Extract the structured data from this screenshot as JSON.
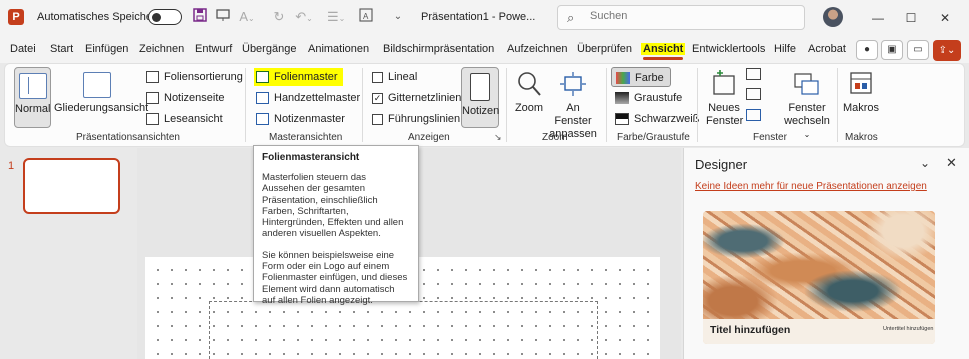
{
  "titlebar": {
    "app_logo": "P",
    "autosave_label": "Automatisches Speichern",
    "autosave_toggle": "off",
    "doc_title": "Präsentation1  -  Powe...",
    "search_placeholder": "Suchen"
  },
  "menu": {
    "tabs": [
      "Datei",
      "Start",
      "Einfügen",
      "Zeichnen",
      "Entwurf",
      "Übergänge",
      "Animationen",
      "Bildschirmpräsentation",
      "Aufzeichnen",
      "Überprüfen",
      "Ansicht",
      "Entwicklertools",
      "Hilfe",
      "Acrobat"
    ],
    "active_tab": "Ansicht"
  },
  "ribbon": {
    "presentation_views": {
      "label": "Präsentationsansichten",
      "normal": "Normal",
      "outline": "Gliederungsansicht",
      "slide_sorter": "Foliensortierung",
      "notes_page": "Notizenseite",
      "reading_view": "Leseansicht"
    },
    "master_views": {
      "label": "Masteransichten",
      "slide_master": "Folienmaster",
      "handout_master": "Handzettelmaster",
      "notes_master": "Notizenmaster"
    },
    "show": {
      "label": "Anzeigen",
      "ruler": "Lineal",
      "gridlines": "Gitternetzlinien",
      "guides": "Führungslinien",
      "notes": "Notizen"
    },
    "zoom": {
      "label": "Zoom",
      "zoom": "Zoom",
      "fit_line1": "An Fenster",
      "fit_line2": "anpassen"
    },
    "color": {
      "label": "Farbe/Graustufe",
      "color": "Farbe",
      "grayscale": "Graustufe",
      "bw": "Schwarzweiß"
    },
    "window": {
      "label": "Fenster",
      "new_window_line1": "Neues",
      "new_window_line2": "Fenster",
      "switch_line1": "Fenster",
      "switch_line2": "wechseln"
    },
    "macros": {
      "label": "Makros",
      "macros": "Makros"
    }
  },
  "slides_pane": {
    "thumb_number": "1"
  },
  "tooltip": {
    "title": "Folienmasteransicht",
    "paragraph1": "Masterfolien steuern das Aussehen der gesamten Präsentation, einschließlich Farben, Schriftarten, Hintergründen, Effekten und allen anderen visuellen Aspekten.",
    "paragraph2": "Sie können beispielsweise eine Form oder ein Logo auf einem Folienmaster einfügen, und dieses Element wird dann automatisch auf allen Folien angezeigt."
  },
  "designer": {
    "title": "Designer",
    "link": "Keine Ideen mehr für neue Präsentationen anzeigen",
    "card_title": "Titel hinzufügen",
    "card_subtitle": "Untertitel hinzufügen"
  },
  "colors": {
    "accent": "#c43e1c",
    "highlight": "#ffff00"
  }
}
